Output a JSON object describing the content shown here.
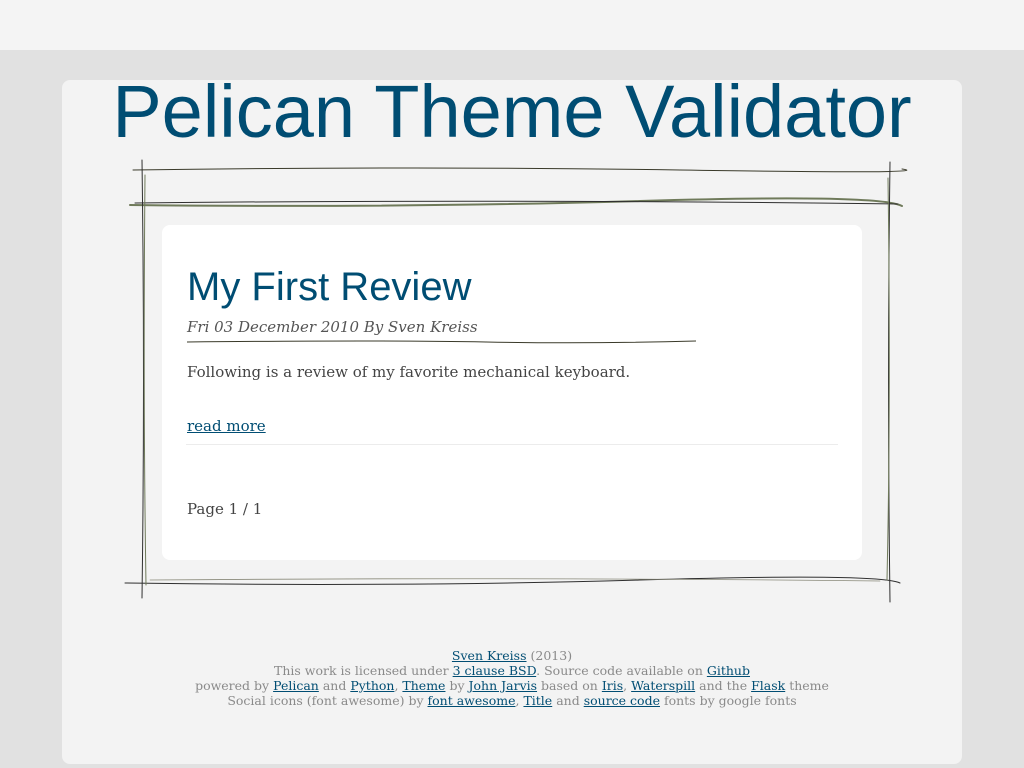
{
  "header": {
    "site_title": "Pelican Theme Validator"
  },
  "article": {
    "title": "My First Review",
    "meta": "Fri 03 December 2010 By Sven Kreiss",
    "summary": "Following is a review of my favorite mechanical keyboard.",
    "read_more": "read more"
  },
  "pagination": {
    "label": "Page 1 / 1"
  },
  "footer": {
    "line1": {
      "author_link": "Sven Kreiss",
      "year": "(2013)"
    },
    "line2": {
      "prefix": "This work is licensed under",
      "license_link": "3 clause BSD",
      "middle": ". Source code available on",
      "github_link": "Github"
    },
    "line3": {
      "powered": "powered by",
      "pelican_link": "Pelican",
      "and1": "and",
      "python_link": "Python",
      "comma1": ",",
      "theme_link": "Theme",
      "by": "by",
      "jarvis_link": "John Jarvis",
      "based_on": "based on",
      "iris_link": "Iris",
      "comma2": ",",
      "waterspill_link": "Waterspill",
      "and_the": "and the",
      "flask_link": "Flask",
      "theme_word": "theme"
    },
    "line4": {
      "social": "Social icons (font awesome) by",
      "fontawesome_link": "font awesome",
      "comma": ",",
      "title_link": "Title",
      "and": "and",
      "source_link": "source code",
      "fonts": "fonts by google fonts"
    }
  },
  "colors": {
    "accent": "#004d73",
    "page_background": "#e1e1e1",
    "panel_background": "#f3f3f3",
    "card_background": "#ffffff",
    "sketch_line": "#3a3a2a"
  }
}
